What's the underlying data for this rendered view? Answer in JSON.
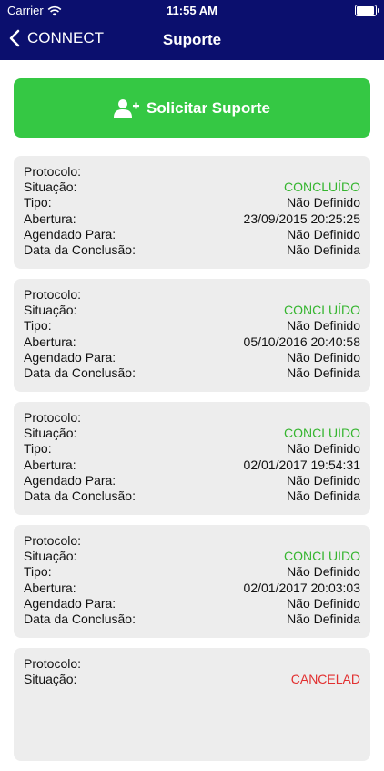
{
  "status_bar": {
    "carrier": "Carrier",
    "time": "11:55 AM"
  },
  "nav": {
    "back_label": "CONNECT",
    "title": "Suporte"
  },
  "cta": {
    "label": "Solicitar Suporte"
  },
  "labels": {
    "protocolo": "Protocolo:",
    "situacao": "Situação:",
    "tipo": "Tipo:",
    "abertura": "Abertura:",
    "agendado": "Agendado Para:",
    "conclusao": "Data da Conclusão:"
  },
  "tickets": [
    {
      "protocolo": "",
      "situacao": "CONCLUÍDO",
      "tipo": "Não Definido",
      "abertura": "23/09/2015 20:25:25",
      "agendado": "Não Definido",
      "conclusao": "Não Definida"
    },
    {
      "protocolo": "",
      "situacao": "CONCLUÍDO",
      "tipo": "Não Definido",
      "abertura": "05/10/2016 20:40:58",
      "agendado": "Não Definido",
      "conclusao": "Não Definida"
    },
    {
      "protocolo": "",
      "situacao": "CONCLUÍDO",
      "tipo": "Não Definido",
      "abertura": "02/01/2017 19:54:31",
      "agendado": "Não Definido",
      "conclusao": "Não Definida"
    },
    {
      "protocolo": "",
      "situacao": "CONCLUÍDO",
      "tipo": "Não Definido",
      "abertura": "02/01/2017 20:03:03",
      "agendado": "Não Definido",
      "conclusao": "Não Definida"
    },
    {
      "protocolo": "",
      "situacao": "CANCELAD"
    }
  ],
  "colors": {
    "header": "#0b0f6e",
    "cta": "#35c844",
    "status_ok": "#35b52f",
    "status_cancel": "#e23030",
    "card": "#ededed"
  }
}
